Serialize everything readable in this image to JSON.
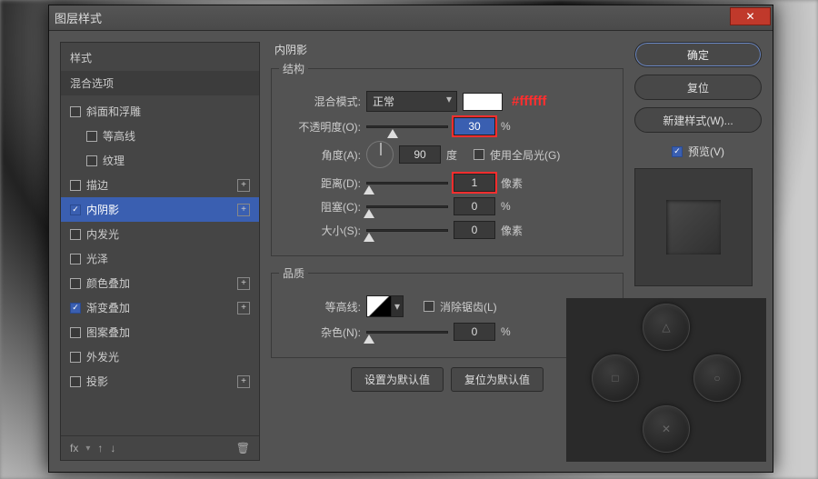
{
  "window": {
    "title": "图层样式"
  },
  "styles": {
    "header": "样式",
    "blend_options": "混合选项",
    "items": [
      {
        "key": "bevel",
        "label": "斜面和浮雕",
        "checked": false,
        "plus": false,
        "indent": false
      },
      {
        "key": "contour_sub",
        "label": "等高线",
        "checked": false,
        "plus": false,
        "indent": true
      },
      {
        "key": "texture_sub",
        "label": "纹理",
        "checked": false,
        "plus": false,
        "indent": true
      },
      {
        "key": "stroke",
        "label": "描边",
        "checked": false,
        "plus": true,
        "indent": false
      },
      {
        "key": "innershadow",
        "label": "内阴影",
        "checked": true,
        "plus": true,
        "indent": false,
        "selected": true
      },
      {
        "key": "innerglow",
        "label": "内发光",
        "checked": false,
        "plus": false,
        "indent": false
      },
      {
        "key": "satin",
        "label": "光泽",
        "checked": false,
        "plus": false,
        "indent": false
      },
      {
        "key": "coloroverlay",
        "label": "颜色叠加",
        "checked": false,
        "plus": true,
        "indent": false
      },
      {
        "key": "gradoverlay",
        "label": "渐变叠加",
        "checked": true,
        "plus": true,
        "indent": false
      },
      {
        "key": "pattoverlay",
        "label": "图案叠加",
        "checked": false,
        "plus": false,
        "indent": false
      },
      {
        "key": "outerglow",
        "label": "外发光",
        "checked": false,
        "plus": false,
        "indent": false
      },
      {
        "key": "dropshadow",
        "label": "投影",
        "checked": false,
        "plus": true,
        "indent": false
      }
    ],
    "footer": {
      "fx": "fx",
      "trash": "🗑"
    }
  },
  "panel": {
    "title": "内阴影",
    "structure": {
      "legend": "结构",
      "blend_mode_label": "混合模式:",
      "blend_mode_value": "正常",
      "color_hex": "#ffffff",
      "opacity_label": "不透明度(O):",
      "opacity_value": "30",
      "opacity_unit": "%",
      "angle_label": "角度(A):",
      "angle_value": "90",
      "angle_unit": "度",
      "use_global_label": "使用全局光(G)",
      "use_global_checked": false,
      "distance_label": "距离(D):",
      "distance_value": "1",
      "distance_unit": "像素",
      "choke_label": "阻塞(C):",
      "choke_value": "0",
      "choke_unit": "%",
      "size_label": "大小(S):",
      "size_value": "0",
      "size_unit": "像素"
    },
    "quality": {
      "legend": "品质",
      "contour_label": "等高线:",
      "antialias_label": "消除锯齿(L)",
      "antialias_checked": false,
      "noise_label": "杂色(N):",
      "noise_value": "0",
      "noise_unit": "%"
    },
    "defaults": {
      "set": "设置为默认值",
      "reset": "复位为默认值"
    }
  },
  "right": {
    "ok": "确定",
    "cancel": "复位",
    "newstyle": "新建样式(W)...",
    "preview_label": "预览(V)",
    "preview_checked": true
  },
  "controller": {
    "up": "△",
    "left": "□",
    "right": "○",
    "down": "✕"
  }
}
